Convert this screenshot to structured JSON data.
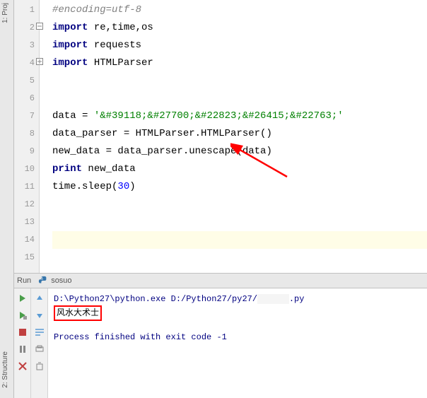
{
  "sidebar": {
    "project_tab": "1: Proj",
    "structure_tab": "2: Structure"
  },
  "gutter": {
    "lines": [
      "1",
      "2",
      "3",
      "4",
      "5",
      "6",
      "7",
      "8",
      "9",
      "10",
      "11",
      "12",
      "13",
      "14",
      "15"
    ]
  },
  "code": {
    "l1_comment": "#encoding=utf-8",
    "l2_kw": "import",
    "l2_rest": " re,time,os",
    "l3_kw": "import",
    "l3_rest": " requests",
    "l4_kw": "import",
    "l4_rest": " HTMLParser",
    "l7_a": "data = ",
    "l7_str": "'&#39118;&#27700;&#22823;&#26415;&#22763;'",
    "l8": "data_parser = HTMLParser.HTMLParser()",
    "l9": "new_data = data_parser.unescape(data)",
    "l10_kw": "print",
    "l10_rest": " new_data",
    "l11_a": "time.sleep(",
    "l11_num": "30",
    "l11_b": ")"
  },
  "run": {
    "label": "Run",
    "config": "sosuo"
  },
  "console": {
    "cmd_a": "D:\\Python27\\python.exe D:/Python27/py27/",
    "cmd_b": ".py",
    "output": "风水大术士",
    "exit": "Process finished with exit code -1"
  }
}
